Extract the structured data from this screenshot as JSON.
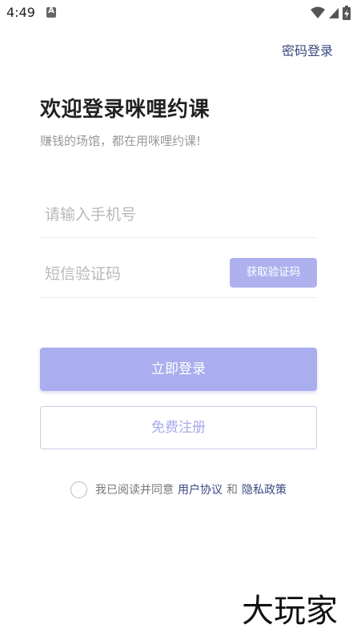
{
  "status_bar": {
    "time": "4:49",
    "notification_letter": "A"
  },
  "header": {
    "password_login_label": "密码登录"
  },
  "main": {
    "title": "欢迎登录咪哩约课",
    "subtitle": "赚钱的场馆，都在用咪哩约课!",
    "phone_placeholder": "请输入手机号",
    "code_placeholder": "短信验证码",
    "get_code_label": "获取验证码",
    "login_label": "立即登录",
    "register_label": "免费注册"
  },
  "agreement": {
    "prefix": "我已阅读并同意",
    "user_agreement": "用户协议",
    "and": "和",
    "privacy_policy": "隐私政策"
  },
  "watermark": {
    "text": "大玩家"
  },
  "colors": {
    "accent": "#aaadee",
    "link": "#3b4a80"
  }
}
